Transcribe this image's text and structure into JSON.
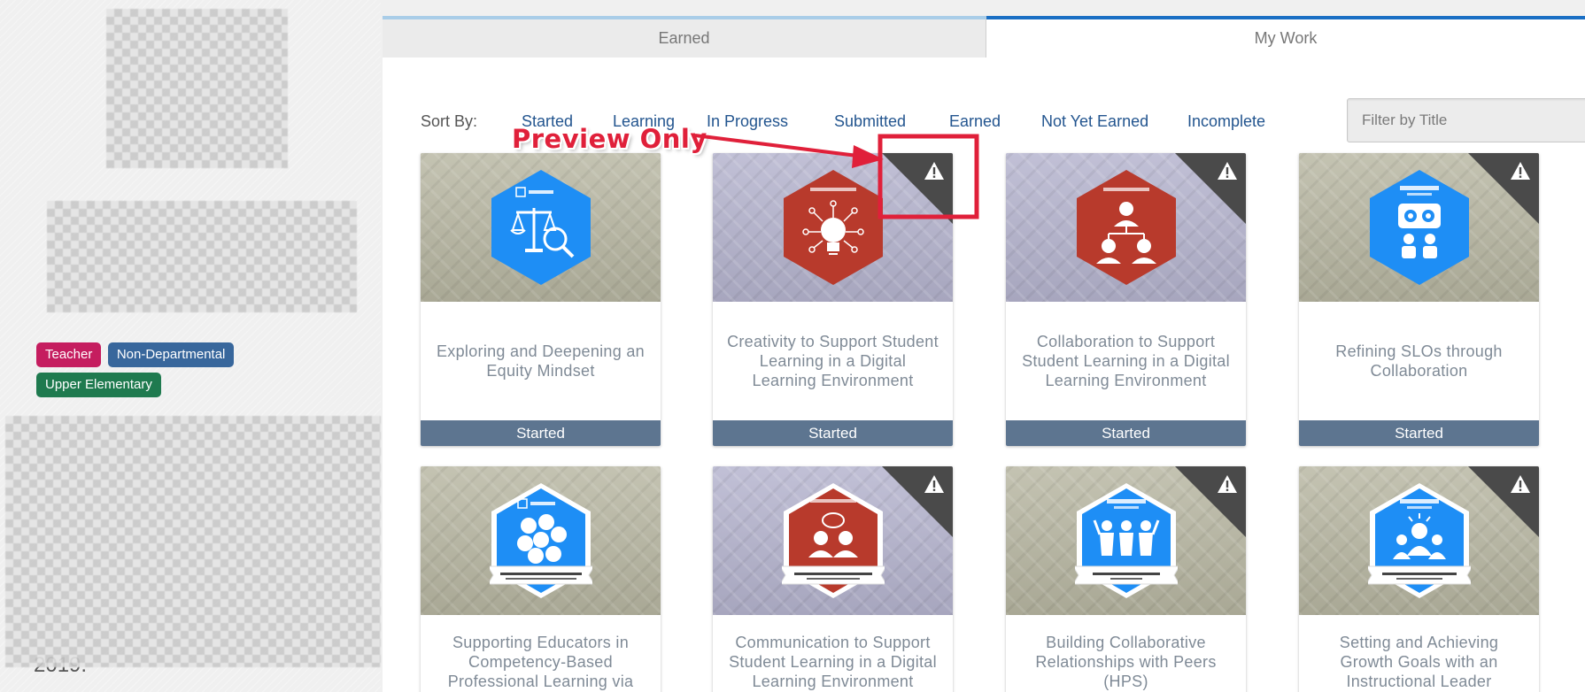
{
  "sidebar": {
    "tags": [
      "Teacher",
      "Non-Departmental",
      "Upper Elementary"
    ],
    "partial_text": "2019."
  },
  "tabs": [
    {
      "label": "Earned"
    },
    {
      "label": "My Work"
    }
  ],
  "sort": {
    "label": "Sort By:",
    "options": [
      "Started",
      "Learning",
      "In Progress",
      "Submitted",
      "Earned",
      "Not Yet Earned",
      "Incomplete"
    ],
    "filter_placeholder": "Filter by Title"
  },
  "annotation": {
    "label": "Preview Only",
    "color": "#e0203a"
  },
  "cards": [
    {
      "title": "Exploring and Deepening an Equity Mindset",
      "status": "Started",
      "badge_color": "#1e8ef5",
      "icon": "scales-magnifier-icon",
      "warning": false
    },
    {
      "title": "Creativity to Support Student Learning in a Digital Learning Environment",
      "status": "Started",
      "badge_color": "#b83a2c",
      "icon": "lightbulb-icon",
      "warning": true
    },
    {
      "title": "Collaboration to Support Student Learning in a Digital Learning Environment",
      "status": "Started",
      "badge_color": "#b83a2c",
      "icon": "people-network-icon",
      "warning": true
    },
    {
      "title": "Refining SLOs through Collaboration",
      "status": "Started",
      "badge_color": "#1e8ef5",
      "icon": "gears-people-icon",
      "warning": true
    },
    {
      "title": "Supporting Educators in Competency-Based Professional Learning via Micro-Credentials",
      "status": "",
      "badge_color": "#1e8ef5",
      "icon": "hex-cluster-icon",
      "warning": false
    },
    {
      "title": "Communication to Support Student Learning in a Digital Learning Environment",
      "status": "",
      "badge_color": "#b83a2c",
      "icon": "speech-people-icon",
      "warning": true
    },
    {
      "title": "Building Collaborative Relationships with Peers (HPS)",
      "status": "",
      "badge_color": "#1e8ef5",
      "icon": "group-hands-up-icon",
      "warning": true
    },
    {
      "title": "Setting and Achieving Growth Goals with an Instructional Leader",
      "status": "",
      "badge_color": "#1e8ef5",
      "icon": "leader-team-icon",
      "warning": true
    }
  ]
}
